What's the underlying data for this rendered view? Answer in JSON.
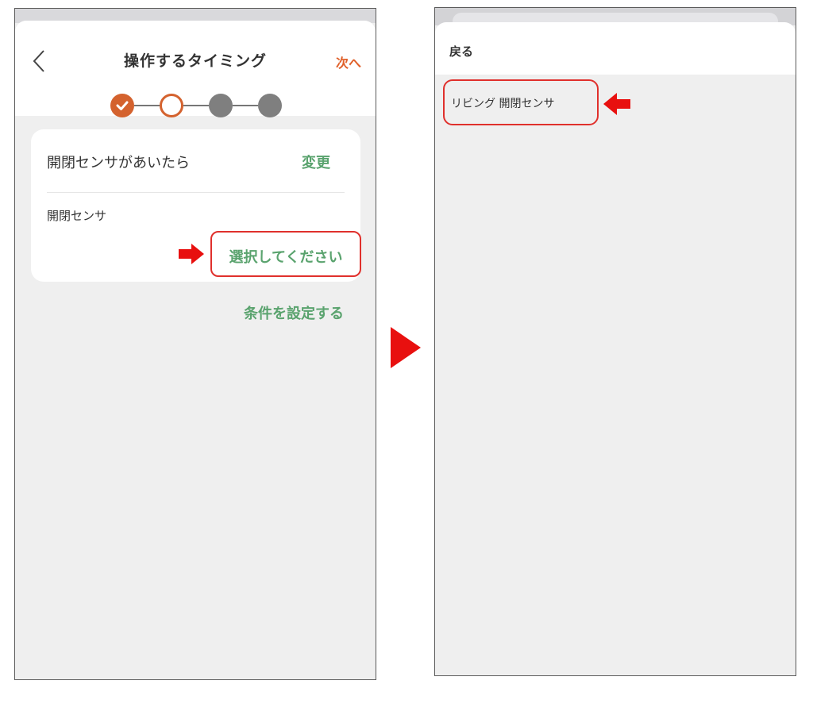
{
  "left_screen": {
    "header": {
      "back_icon": "chevron-left-icon",
      "title": "操作するタイミング",
      "next_label": "次へ"
    },
    "stepper": {
      "steps": [
        "done",
        "current",
        "todo",
        "todo"
      ],
      "current_step": 2,
      "total_steps": 4
    },
    "card": {
      "condition_title": "開閉センサがあいたら",
      "change_label": "変更",
      "sensor_label": "開閉センサ",
      "select_label": "選択してください"
    },
    "set_condition_label": "条件を設定する"
  },
  "right_screen": {
    "back_label": "戻る",
    "items": [
      "リビング 開閉センサ"
    ]
  },
  "colors": {
    "accent_orange": "#d4622e",
    "link_orange": "#e0602a",
    "action_green": "#5aa36e",
    "highlight_red": "#e0302c",
    "background_gray": "#efefef"
  }
}
